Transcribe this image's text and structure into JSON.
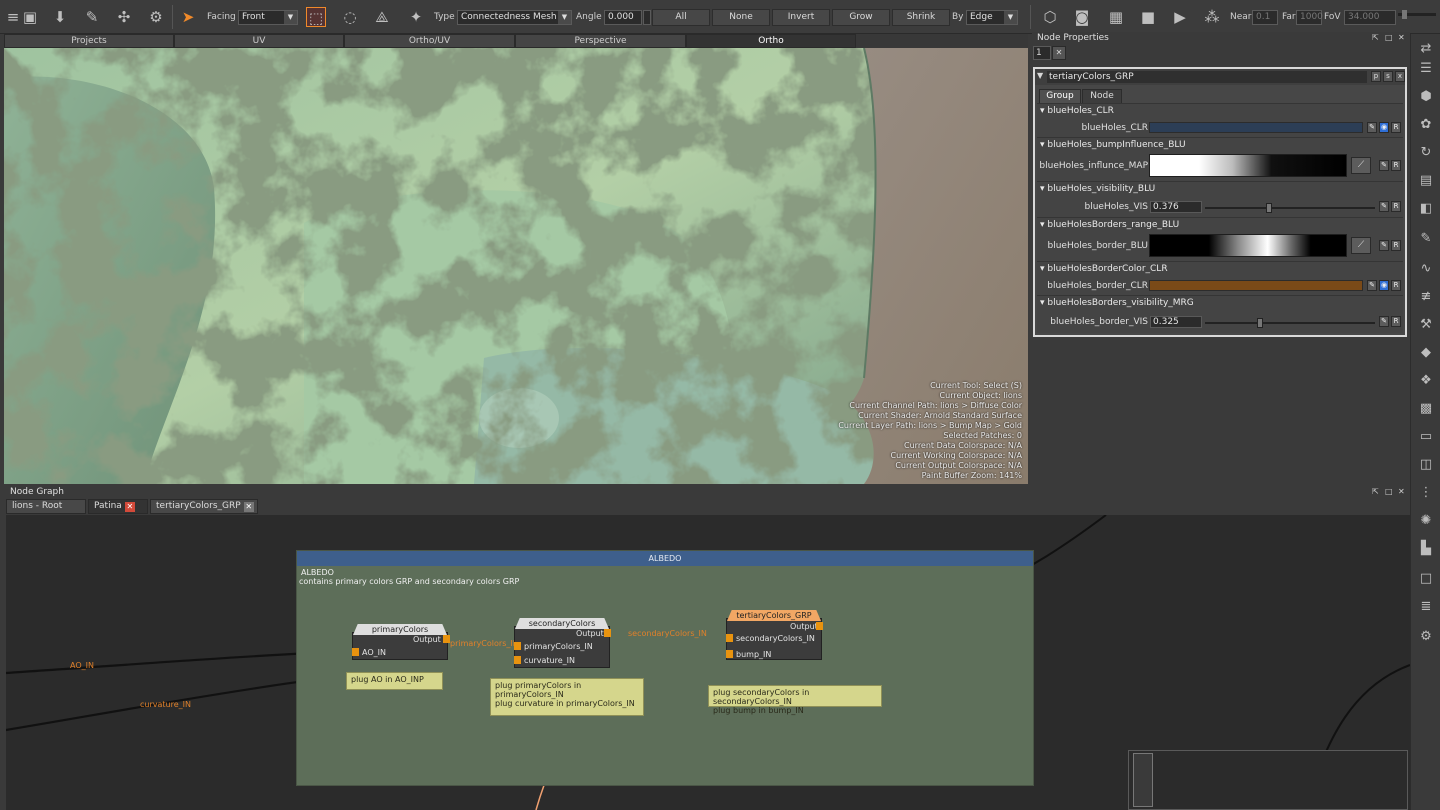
{
  "toolbar": {
    "facing_label": "Facing",
    "facing_value": "Front",
    "type_label": "Type",
    "type_value": "Connectedness Mesh",
    "angle_label": "Angle",
    "angle_value": "0.000",
    "buttons": [
      "All",
      "None",
      "Invert",
      "Grow",
      "Shrink"
    ],
    "by_label": "By",
    "by_value": "Edge",
    "near_label": "Near",
    "near_value": "0.1",
    "far_label": "Far",
    "far_value": "1000",
    "fov_label": "FoV",
    "fov_value": "34.000"
  },
  "viewport_tabs": [
    "Projects",
    "UV",
    "Ortho/UV",
    "Perspective",
    "Ortho"
  ],
  "hud": [
    "Current Tool: Select (S)",
    "Current Object: lions",
    "Current Channel Path: lions > Diffuse Color",
    "Current Shader: Arnold Standard Surface",
    "Current Layer Path: lions > Bump Map > Gold",
    "Selected Patches: 0",
    "Current Data Colorspace: N/A",
    "Current Working Colorspace: N/A",
    "Current Output Colorspace: N/A",
    "Paint Buffer Zoom: 141%"
  ],
  "node_properties": {
    "title": "Node Properties",
    "count": "1",
    "group_name": "tertiaryColors_GRP",
    "tabs": [
      "Group",
      "Node"
    ],
    "sections": [
      {
        "title": "blueHoles_CLR",
        "label": "blueHoles_CLR",
        "kind": "color",
        "color": "#2c3e56"
      },
      {
        "title": "blueHoles_bumpInfluence_BLU",
        "label": "blueHoles_influnce_MAP",
        "kind": "ramp"
      },
      {
        "title": "blueHoles_visibility_BLU",
        "label": "blueHoles_VIS",
        "kind": "slider",
        "value": "0.376",
        "fraction": 0.376
      },
      {
        "title": "blueHolesBorders_range_BLU",
        "label": "blueHoles_border_BLU",
        "kind": "ramp"
      },
      {
        "title": "blueHolesBorderColor_CLR",
        "label": "blueHoles_border_CLR",
        "kind": "color",
        "color": "#7a4a18"
      },
      {
        "title": "blueHolesBorders_visibility_MRG",
        "label": "blueHoles_border_VIS",
        "kind": "slider",
        "value": "0.325",
        "fraction": 0.325
      }
    ]
  },
  "node_graph": {
    "title": "Node Graph",
    "tabs": [
      "lions - Root",
      "Patina",
      "tertiaryColors_GRP"
    ],
    "backdrop_bar": "ALBEDO",
    "backdrop_title": "ALBEDO",
    "backdrop_desc": "contains primary colors GRP and secondary colors GRP",
    "nodes": {
      "primary": {
        "name": "primaryColors",
        "output": "Output",
        "inputs": [
          "AO_IN"
        ]
      },
      "secondary": {
        "name": "secondaryColors",
        "output": "Output",
        "inputs": [
          "primaryColors_IN",
          "curvature_IN"
        ]
      },
      "tertiary": {
        "name": "tertiaryColors_GRP",
        "output": "Output",
        "inputs": [
          "secondaryColors_IN",
          "bump_IN"
        ]
      }
    },
    "notes": [
      "plug AO in AO_INP",
      "plug primaryColors in primaryColors_IN",
      "plug curvature in primaryColors_IN",
      "plug secondaryColors in secondaryColors_IN",
      "plug bump in bump_IN"
    ],
    "wire_labels": [
      "AO_IN",
      "curvature_IN",
      "primaryColors_IN",
      "secondaryColors_IN"
    ],
    "colors": {
      "wire_orange": "#f0a070",
      "port": "#e8930f",
      "backdrop": "#5d6e59",
      "backdrop_bar": "#3e5f8c"
    }
  }
}
